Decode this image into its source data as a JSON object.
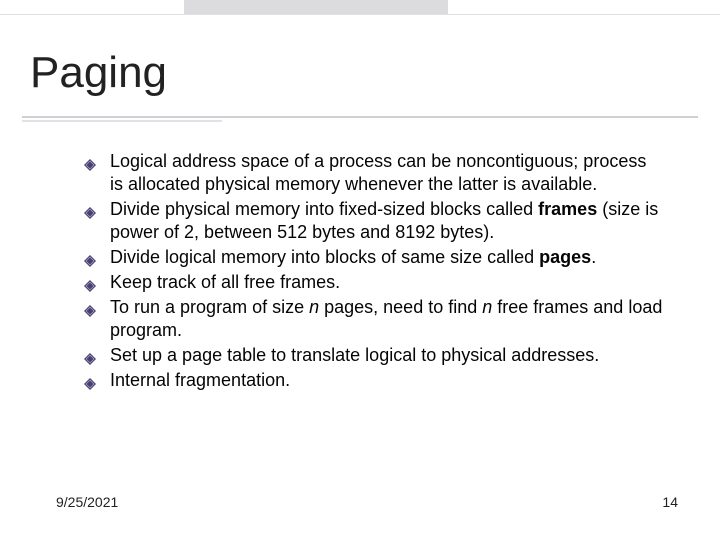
{
  "slide": {
    "title": "Paging",
    "bullets": [
      "Logical address space of a process can be noncontiguous; process is allocated physical memory whenever the latter is available.",
      "Divide physical memory into fixed-sized blocks called <b>frames</b> (size is power of 2, between 512 bytes and 8192 bytes).",
      "Divide logical memory into blocks of same size called <b>pages</b>.",
      "Keep track of all free frames.",
      "To run a program of size <i>n</i> pages, need to find <i>n</i> free frames and load program.",
      "Set up a page table to translate logical to physical addresses.",
      "Internal fragmentation."
    ]
  },
  "footer": {
    "date": "9/25/2021",
    "page": "14"
  },
  "icons": {
    "bullet": "diamond-icon"
  },
  "colors": {
    "bullet_fill": "#4a3f73",
    "bullet_edge": "#8d84ad"
  }
}
